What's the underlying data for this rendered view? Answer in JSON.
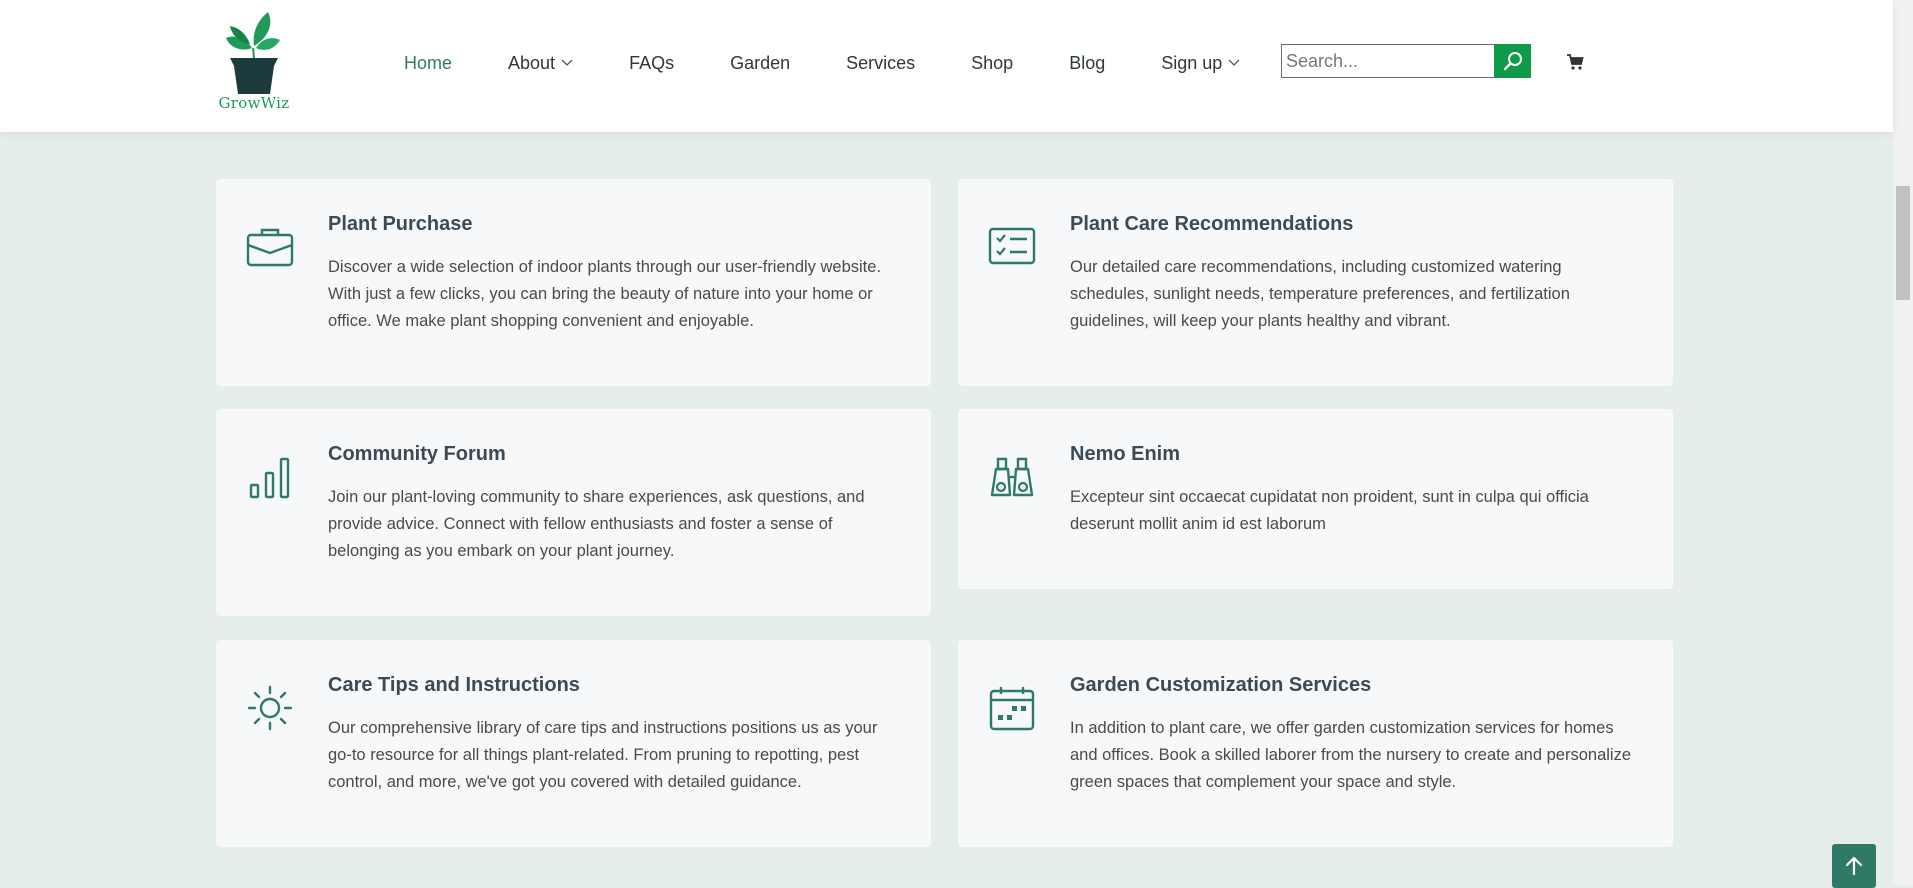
{
  "brand": {
    "name": "GrowWiz"
  },
  "nav": {
    "items": [
      {
        "label": "Home",
        "active": true
      },
      {
        "label": "About",
        "dropdown": true
      },
      {
        "label": "FAQs"
      },
      {
        "label": "Garden"
      },
      {
        "label": "Services"
      },
      {
        "label": "Shop"
      },
      {
        "label": "Blog"
      },
      {
        "label": "Sign up",
        "dropdown": true
      }
    ]
  },
  "search": {
    "placeholder": "Search...",
    "value": ""
  },
  "services": [
    {
      "icon": "briefcase-icon",
      "title": "Plant Purchase",
      "description": "Discover a wide selection of indoor plants through our user-friendly website. With just a few clicks, you can bring the beauty of nature into your home or office. We make plant shopping convenient and enjoyable."
    },
    {
      "icon": "checklist-icon",
      "title": "Plant Care Recommendations",
      "description": "Our detailed care recommendations, including customized watering schedules, sunlight needs, temperature preferences, and fertilization guidelines, will keep your plants healthy and vibrant."
    },
    {
      "icon": "bar-chart-icon",
      "title": "Community Forum",
      "description": "Join our plant-loving community to share experiences, ask questions, and provide advice. Connect with fellow enthusiasts and foster a sense of belonging as you embark on your plant journey."
    },
    {
      "icon": "binoculars-icon",
      "title": "Nemo Enim",
      "description": "Excepteur sint occaecat cupidatat non proident, sunt in culpa qui officia deserunt mollit anim id est laborum"
    },
    {
      "icon": "sun-icon",
      "title": "Care Tips and Instructions",
      "description": "Our comprehensive library of care tips and instructions positions us as your go-to resource for all things plant-related. From pruning to repotting, pest control, and more, we've got you covered with detailed guidance."
    },
    {
      "icon": "calendar-icon",
      "title": "Garden Customization Services",
      "description": "In addition to plant care, we offer garden customization services for homes and offices. Book a skilled laborer from the nursery to create and personalize green spaces that complement your space and style."
    }
  ],
  "colors": {
    "accent": "#2f7a66",
    "search_button": "#0e9a47",
    "page_background": "#e6eeeb",
    "card_background": "#f6f8f9"
  }
}
